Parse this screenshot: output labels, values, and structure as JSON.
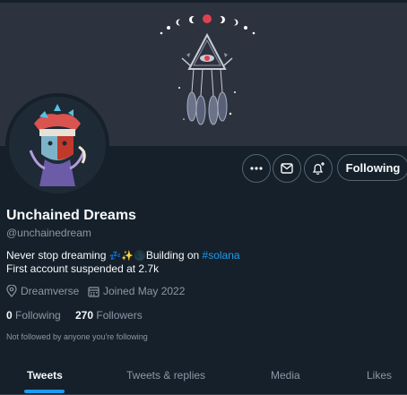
{
  "profile": {
    "name": "Unchained Dreams",
    "handle": "@unchainedream",
    "bio_line1_prefix": "Never stop dreaming ",
    "bio_line1_emoji": "💤✨🌑",
    "bio_line1_mid": "Building on ",
    "bio_hashtag": "#solana",
    "bio_line2": "First account suspended at 2.7k",
    "location": "Dreamverse",
    "joined": "Joined May 2022",
    "following_count": "0",
    "following_label": "Following",
    "followers_count": "270",
    "followers_label": "Followers",
    "followed_by_note": "Not followed by anyone you're following"
  },
  "actions": {
    "more_icon": "more-icon",
    "message_icon": "envelope-icon",
    "notify_icon": "bell-plus-icon",
    "follow_label": "Following"
  },
  "tabs": [
    {
      "label": "Tweets",
      "active": true
    },
    {
      "label": "Tweets & replies",
      "active": false
    },
    {
      "label": "Media",
      "active": false
    },
    {
      "label": "Likes",
      "active": false
    }
  ],
  "colors": {
    "background": "#15202b",
    "banner": "#2c323e",
    "accent": "#1d9bf0",
    "muted_text": "#8b98a5",
    "primary_text": "#f7f9f9",
    "moon_red": "#e0414f"
  }
}
